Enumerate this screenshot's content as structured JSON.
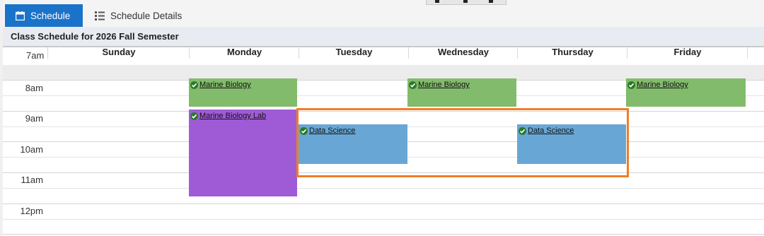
{
  "tabs": [
    {
      "label": "Schedule",
      "icon": "calendar-icon",
      "active": true
    },
    {
      "label": "Schedule Details",
      "icon": "list-icon",
      "active": false
    }
  ],
  "title": "Class Schedule for 2026 Fall Semester",
  "days": [
    "Sunday",
    "Monday",
    "Tuesday",
    "Wednesday",
    "Thursday",
    "Friday"
  ],
  "times": [
    "7am",
    "8am",
    "9am",
    "10am",
    "11am",
    "12pm"
  ],
  "events": [
    {
      "name": "Marine Biology",
      "day": "Monday",
      "start": "8am",
      "end": "9am",
      "color": "#82bb6b"
    },
    {
      "name": "Marine Biology",
      "day": "Wednesday",
      "start": "8am",
      "end": "9am",
      "color": "#82bb6b"
    },
    {
      "name": "Marine Biology",
      "day": "Friday",
      "start": "8am",
      "end": "9am",
      "color": "#82bb6b"
    },
    {
      "name": "Marine Biology Lab",
      "day": "Monday",
      "start": "9am",
      "end": "11:30am",
      "color": "#9f5bd6"
    },
    {
      "name": "Data Science",
      "day": "Tuesday",
      "start": "9:30am",
      "end": "10:45am",
      "color": "#68a7d5"
    },
    {
      "name": "Data Science",
      "day": "Thursday",
      "start": "9:30am",
      "end": "10:45am",
      "color": "#68a7d5"
    }
  ],
  "highlight_color": "#f07d28"
}
